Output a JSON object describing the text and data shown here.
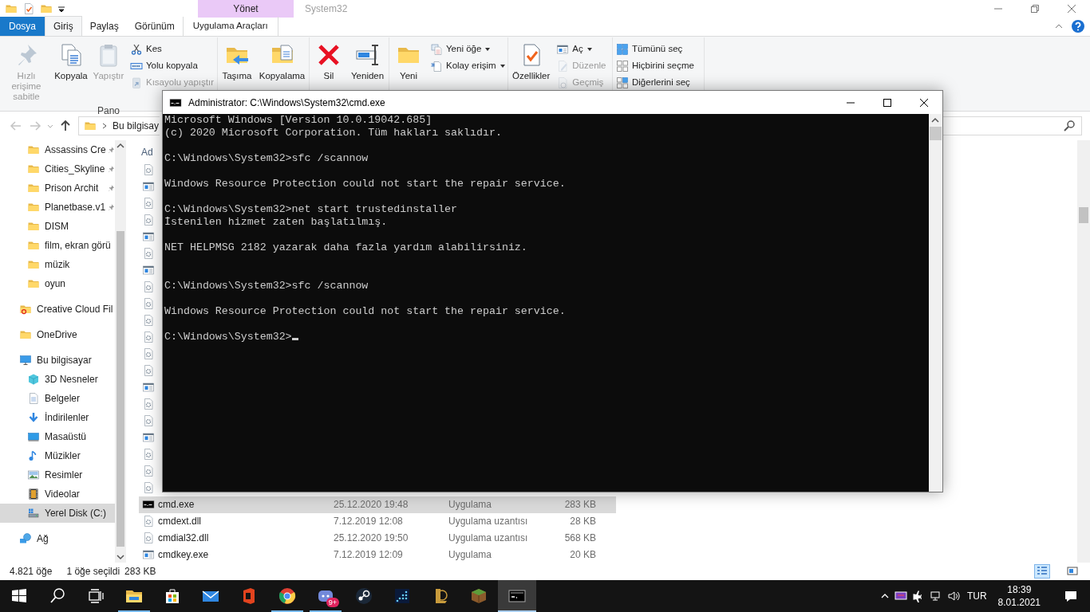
{
  "explorer": {
    "title": "System32",
    "context_group": "Yönet",
    "tabs": [
      {
        "label": "Dosya",
        "kind": "file",
        "selected": false
      },
      {
        "label": "Giriş",
        "kind": "tab",
        "selected": true
      },
      {
        "label": "Paylaş",
        "kind": "tab",
        "selected": false
      },
      {
        "label": "Görünüm",
        "kind": "tab",
        "selected": false
      },
      {
        "label": "Uygulama Araçları",
        "kind": "context",
        "selected": false
      }
    ],
    "ribbon": {
      "groups": [
        {
          "label": "Pano",
          "items": [
            {
              "label": "Hızlı erişime sabitle",
              "kind": "large",
              "disabled": true
            },
            {
              "label": "Kopyala",
              "kind": "large",
              "disabled": false
            },
            {
              "label": "Yapıştır",
              "kind": "large",
              "disabled": true
            },
            {
              "label": "Kes",
              "kind": "small",
              "disabled": false,
              "dropdown": false
            },
            {
              "label": "Yolu kopyala",
              "kind": "small",
              "disabled": false,
              "dropdown": false
            },
            {
              "label": "Kısayolu yapıştır",
              "kind": "small",
              "disabled": true,
              "dropdown": false
            }
          ]
        },
        {
          "items": [
            {
              "label": "Taşıma",
              "kind": "large",
              "disabled": false
            },
            {
              "label": "Kopyalama",
              "kind": "large",
              "disabled": false
            }
          ]
        },
        {
          "items": [
            {
              "label": "Sil",
              "kind": "large",
              "disabled": false
            },
            {
              "label": "Yeniden",
              "kind": "large",
              "disabled": false
            }
          ]
        },
        {
          "items": [
            {
              "label": "Yeni",
              "kind": "large",
              "disabled": false
            },
            {
              "label": "Yeni öğe",
              "kind": "small",
              "disabled": false,
              "dropdown": true
            },
            {
              "label": "Kolay erişim",
              "kind": "small",
              "disabled": false,
              "dropdown": true
            }
          ]
        },
        {
          "items": [
            {
              "label": "Özellikler",
              "kind": "large",
              "disabled": false
            },
            {
              "label": "Aç",
              "kind": "small",
              "disabled": false,
              "dropdown": true
            },
            {
              "label": "Düzenle",
              "kind": "small",
              "disabled": true,
              "dropdown": false
            },
            {
              "label": "Geçmiş",
              "kind": "small",
              "disabled": true,
              "dropdown": false
            }
          ]
        },
        {
          "items": [
            {
              "label": "Tümünü seç",
              "kind": "small",
              "disabled": false,
              "dropdown": false
            },
            {
              "label": "Hiçbirini seçme",
              "kind": "small",
              "disabled": false,
              "dropdown": false
            },
            {
              "label": "Diğerlerini seç",
              "kind": "small",
              "disabled": false,
              "dropdown": false
            }
          ]
        }
      ]
    },
    "navigation": {
      "back": {
        "disabled": true
      },
      "forward": {
        "disabled": true
      },
      "address": "Bu bilgisay"
    },
    "quick_access": [
      {
        "label": "Assassins Cre",
        "pinned": true,
        "selected": false
      },
      {
        "label": "Cities_Skyline",
        "pinned": true,
        "selected": false
      },
      {
        "label": "Prison Archit",
        "pinned": true,
        "selected": false
      },
      {
        "label": "Planetbase.v1",
        "pinned": true,
        "selected": false
      },
      {
        "label": "DISM",
        "pinned": false,
        "selected": false
      },
      {
        "label": "film, ekran görü",
        "pinned": false,
        "selected": false
      },
      {
        "label": "müzik",
        "pinned": false,
        "selected": false
      },
      {
        "label": "oyun",
        "pinned": false,
        "selected": false
      }
    ],
    "tree": [
      {
        "label": "Creative Cloud Fil",
        "selected": false
      },
      {
        "label": "OneDrive",
        "selected": false
      },
      {
        "label": "Bu bilgisayar",
        "selected": false,
        "children": [
          {
            "label": "3D Nesneler",
            "selected": false
          },
          {
            "label": "Belgeler",
            "selected": false
          },
          {
            "label": "İndirilenler",
            "selected": false
          },
          {
            "label": "Masaüstü",
            "selected": false
          },
          {
            "label": "Müzikler",
            "selected": false
          },
          {
            "label": "Resimler",
            "selected": false
          },
          {
            "label": "Videolar",
            "selected": false
          },
          {
            "label": "Yerel Disk (C:)",
            "selected": true
          }
        ]
      },
      {
        "label": "Ağ",
        "selected": false
      }
    ],
    "file_list": {
      "columns": [
        "Ad"
      ],
      "rows": [
        {
          "kind": "dll",
          "selected": false
        },
        {
          "kind": "app",
          "selected": false
        },
        {
          "kind": "dll",
          "selected": false
        },
        {
          "kind": "dll",
          "selected": false
        },
        {
          "kind": "app",
          "selected": false
        },
        {
          "kind": "dll",
          "selected": false
        },
        {
          "kind": "app",
          "selected": false
        },
        {
          "kind": "dll",
          "selected": false
        },
        {
          "kind": "dll",
          "selected": false
        },
        {
          "kind": "dll",
          "selected": false
        },
        {
          "kind": "dll",
          "selected": false
        },
        {
          "kind": "dll",
          "selected": false
        },
        {
          "kind": "dll",
          "selected": false
        },
        {
          "kind": "app",
          "selected": false
        },
        {
          "kind": "dll",
          "selected": false
        },
        {
          "kind": "dll",
          "selected": false
        },
        {
          "kind": "app",
          "selected": false
        },
        {
          "kind": "dll",
          "selected": false
        },
        {
          "kind": "dll",
          "selected": false
        },
        {
          "kind": "dll",
          "selected": false
        },
        {
          "kind": "console",
          "name": "cmd.exe",
          "date": "25.12.2020 19:48",
          "type": "Uygulama",
          "size": "283 KB",
          "selected": true
        },
        {
          "kind": "dll",
          "name": "cmdext.dll",
          "date": "7.12.2019 12:08",
          "type": "Uygulama uzantısı",
          "size": "28 KB",
          "selected": false
        },
        {
          "kind": "dll",
          "name": "cmdial32.dll",
          "date": "25.12.2020 19:50",
          "type": "Uygulama uzantısı",
          "size": "568 KB",
          "selected": false
        },
        {
          "kind": "app",
          "name": "cmdkey.exe",
          "date": "7.12.2019 12:09",
          "type": "Uygulama",
          "size": "20 KB",
          "selected": false
        }
      ]
    },
    "status_bar": {
      "item_count": "4.821 öğe",
      "selection": "1 öğe seçildi",
      "selection_size": "283 KB",
      "view_buttons": [
        {
          "selected": true
        },
        {
          "selected": false
        }
      ]
    }
  },
  "console_window": {
    "title": "Administrator: C:\\Windows\\System32\\cmd.exe",
    "blocks": [
      {
        "lines": [
          "Microsoft Windows [Version 10.0.19042.685]",
          "(c) 2020 Microsoft Corporation. Tüm hakları saklıdır."
        ],
        "extra_gap": false,
        "cursor": false
      },
      {
        "lines": [
          "C:\\Windows\\System32>sfc /scannow"
        ],
        "extra_gap": false,
        "cursor": false
      },
      {
        "lines": [
          "Windows Resource Protection could not start the repair service."
        ],
        "extra_gap": false,
        "cursor": false
      },
      {
        "lines": [
          "C:\\Windows\\System32>net start trustedinstaller",
          "İstenilen hizmet zaten başlatılmış."
        ],
        "extra_gap": false,
        "cursor": false
      },
      {
        "lines": [
          "NET HELPMSG 2182 yazarak daha fazla yardım alabilirsiniz."
        ],
        "extra_gap": true,
        "cursor": false
      },
      {
        "lines": [
          "C:\\Windows\\System32>sfc /scannow"
        ],
        "extra_gap": false,
        "cursor": false
      },
      {
        "lines": [
          "Windows Resource Protection could not start the repair service."
        ],
        "extra_gap": false,
        "cursor": false
      },
      {
        "lines": [
          "C:\\Windows\\System32>"
        ],
        "extra_gap": false,
        "cursor": true
      }
    ]
  },
  "taskbar": {
    "apps": [
      {
        "running": true,
        "active": false
      },
      {
        "running": false,
        "active": false
      },
      {
        "running": false,
        "active": false
      },
      {
        "running": false,
        "active": false
      },
      {
        "running": true,
        "active": false
      },
      {
        "running": true,
        "active": false,
        "badge": "9+"
      },
      {
        "running": false,
        "active": false
      },
      {
        "running": false,
        "active": false
      },
      {
        "running": false,
        "active": false
      },
      {
        "running": false,
        "active": false
      },
      {
        "running": true,
        "active": true
      }
    ],
    "language": "TUR",
    "time": "18:39",
    "date": "8.01.2021"
  }
}
